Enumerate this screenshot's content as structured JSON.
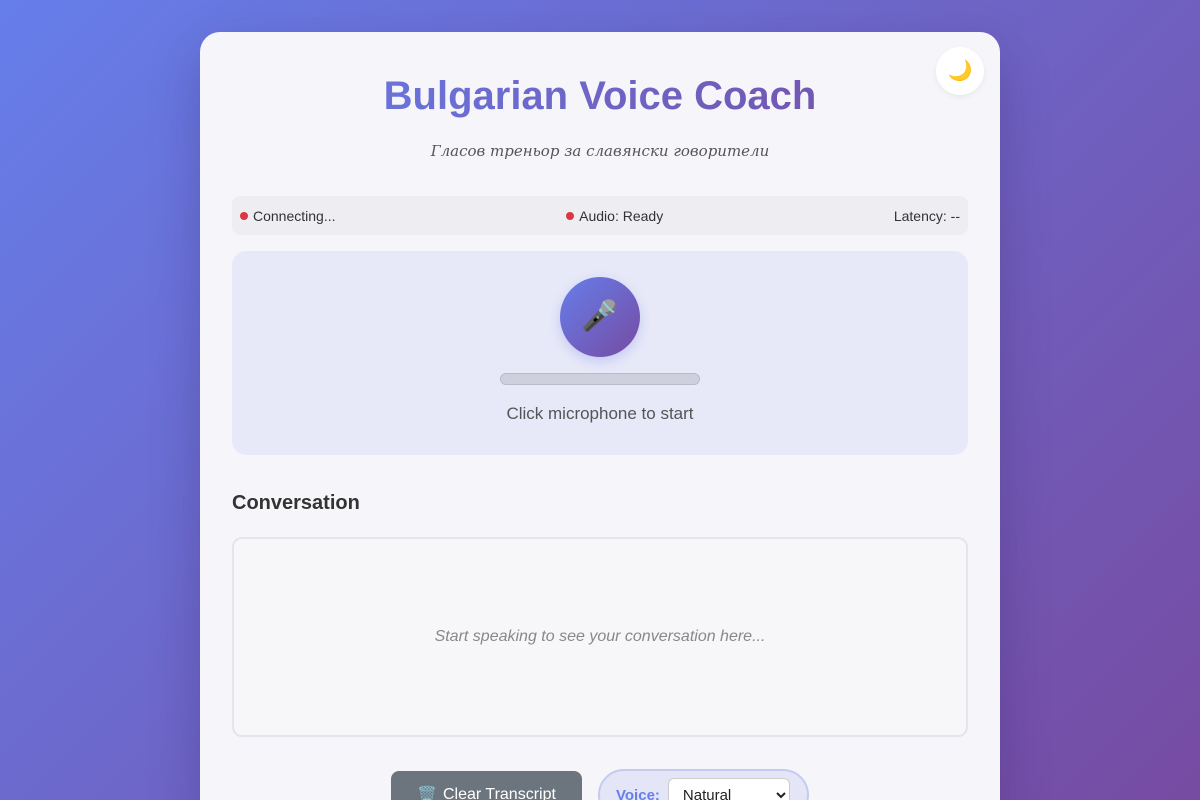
{
  "app": {
    "title": "Bulgarian Voice Coach",
    "subtitle": "Гласов треньор за славянски говорители",
    "theme_toggle_icon": "🌙"
  },
  "status": {
    "connection": "Connecting...",
    "audio": "Audio: Ready",
    "latency": "Latency: --",
    "indicator_color": "#dc3545"
  },
  "voice": {
    "mic_icon": "🎤",
    "status_text": "Click microphone to start",
    "audio_level_fraction": 0
  },
  "conversation": {
    "heading": "Conversation",
    "placeholder": "Start speaking to see your conversation here..."
  },
  "controls": {
    "clear_icon": "🗑️",
    "clear_label": "Clear Transcript",
    "voice_label": "Voice:",
    "voice_selected": "Natural"
  },
  "colors": {
    "accent_start": "#667eea",
    "accent_end": "#764ba2"
  }
}
